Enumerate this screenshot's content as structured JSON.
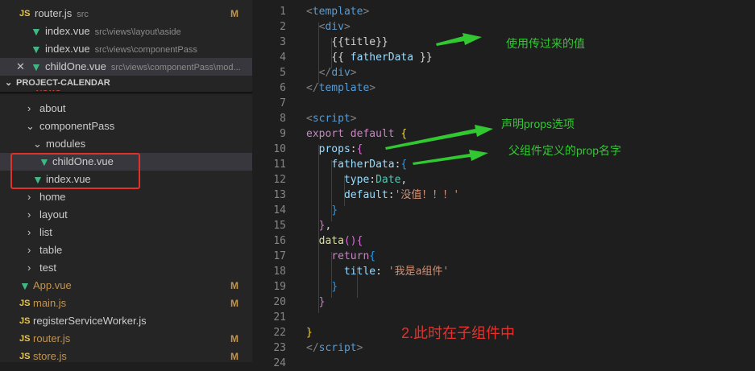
{
  "explorer": {
    "open_files": [
      {
        "name": "router.js",
        "path": "src",
        "badge": "M",
        "type": "js"
      },
      {
        "name": "index.vue",
        "path": "src\\views\\layout\\aside",
        "badge": "",
        "type": "vue"
      },
      {
        "name": "index.vue",
        "path": "src\\views\\componentPass",
        "badge": "",
        "type": "vue"
      },
      {
        "name": "childOne.vue",
        "path": "src\\views\\componentPass\\mod...",
        "badge": "",
        "type": "vue"
      }
    ],
    "project_title": "PROJECT-CALENDAR",
    "tree": [
      {
        "label": "views",
        "badge": ""
      },
      {
        "label": "about"
      },
      {
        "label": "componentPass"
      },
      {
        "label": "modules"
      },
      {
        "label": "childOne.vue"
      },
      {
        "label": "index.vue"
      },
      {
        "label": "home"
      },
      {
        "label": "layout"
      },
      {
        "label": "list"
      },
      {
        "label": "table"
      },
      {
        "label": "test"
      },
      {
        "label": "App.vue",
        "badge": "M"
      },
      {
        "label": "main.js",
        "badge": "M"
      },
      {
        "label": "registerServiceWorker.js"
      },
      {
        "label": "router.js",
        "badge": "M"
      },
      {
        "label": "store.js",
        "badge": "M"
      }
    ]
  },
  "editor": {
    "line_numbers": [
      "1",
      "2",
      "3",
      "4",
      "5",
      "6",
      "7",
      "8",
      "9",
      "10",
      "11",
      "12",
      "13",
      "14",
      "15",
      "16",
      "17",
      "18",
      "19",
      "20",
      "21",
      "22",
      "23",
      "24"
    ]
  },
  "annotations": {
    "a1": "使用传过来的值",
    "a2": "声明props选项",
    "a3": "父组件定义的prop名字",
    "a4": "2.此时在子组件中"
  },
  "colors": {
    "arrow": "#32c832",
    "highlight_box": "#e0312b",
    "vue_icon": "#41b883",
    "js_icon": "#e8c547"
  }
}
